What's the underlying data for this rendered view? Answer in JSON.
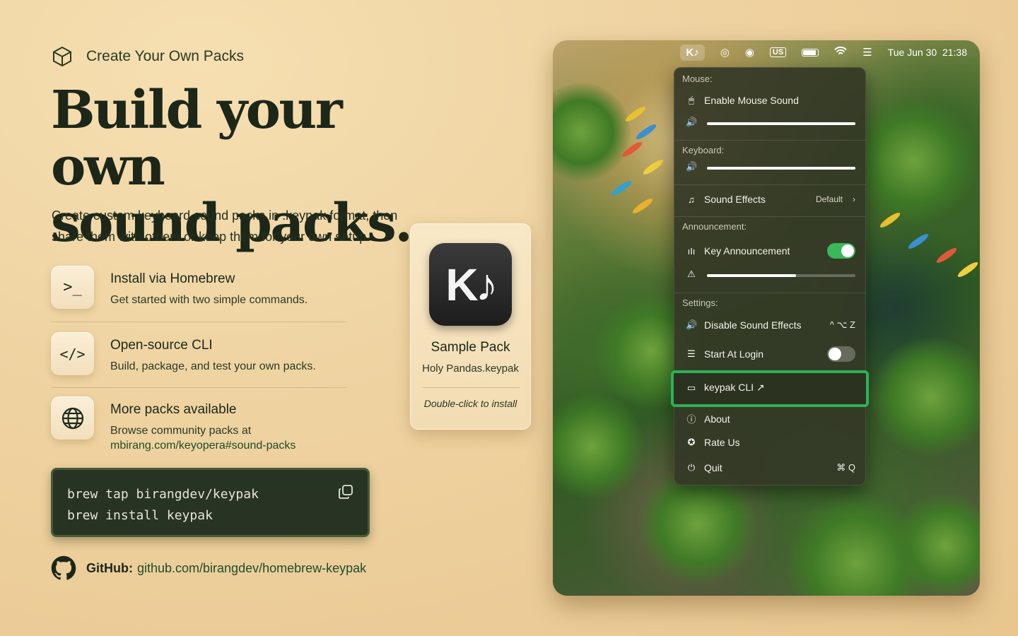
{
  "eyebrow": {
    "icon": "cube-icon",
    "text": "Create Your Own Packs"
  },
  "headline": {
    "line1": "Build your own",
    "line2": "sound packs."
  },
  "lead": "Create custom keyboard sound packs in .keypak format, then share them with others or keep them for your own setup.",
  "features": [
    {
      "icon": "terminal-icon",
      "glyph": ">_",
      "title": "Install via Homebrew",
      "desc": "Get started with two simple commands."
    },
    {
      "icon": "code-icon",
      "glyph": "</>",
      "title": "Open-source CLI",
      "desc": "Build, package, and test your own packs."
    },
    {
      "icon": "globe-icon",
      "title": "More packs available",
      "desc": "Browse community packs at",
      "link": "mbirang.com/keyopera#sound-packs"
    }
  ],
  "code": {
    "line1": "brew tap birangdev/keypak",
    "line2": "brew install keypak",
    "copy_icon": "copy-icon"
  },
  "github": {
    "icon": "github-icon",
    "label": "GitHub:",
    "link": "github.com/birangdev/homebrew-keypak"
  },
  "pack_card": {
    "icon_text": "K♪",
    "title": "Sample Pack",
    "file": "Holy Pandas.keypak",
    "hint": "Double-click to install"
  },
  "menubar": {
    "app": "K♪",
    "icons": [
      "airdrop-icon",
      "record-icon",
      "battery-icon",
      "wifi-icon",
      "control-center-icon"
    ],
    "input_source": "US",
    "clock": "Tue Jun 30  21:38"
  },
  "menu": {
    "mouse": {
      "section": "Mouse:",
      "enable_label": "Enable Mouse Sound",
      "volume": 1.0
    },
    "keyboard": {
      "section": "Keyboard:",
      "volume": 1.0,
      "sound_effects_label": "Sound Effects",
      "sound_effects_value": "Default"
    },
    "announcement": {
      "section": "Announcement:",
      "key_announcement_label": "Key Announcement",
      "key_announcement_on": true,
      "volume": 0.6
    },
    "settings": {
      "section": "Settings:",
      "disable_label": "Disable Sound Effects",
      "disable_shortcut": "^ ⌥ Z",
      "start_login_label": "Start At Login",
      "start_login_on": false
    },
    "cli_label": "keypak CLI ↗",
    "about_label": "About",
    "rate_label": "Rate Us",
    "quit_label": "Quit",
    "quit_shortcut": "⌘ Q"
  }
}
